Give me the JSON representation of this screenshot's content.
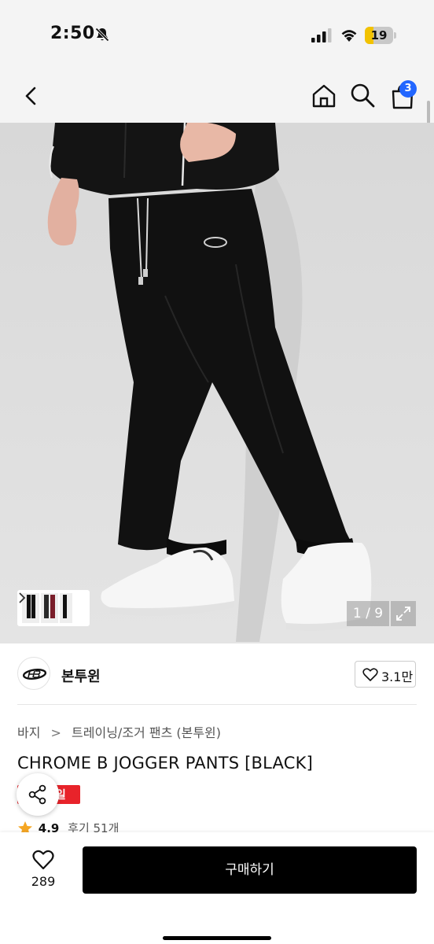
{
  "status_bar": {
    "time": "2:50",
    "battery": "19",
    "icons": [
      "bell-slash-icon",
      "cellular-signal-icon",
      "wifi-icon",
      "battery-icon"
    ]
  },
  "nav": {
    "icons": [
      "back-chevron-icon",
      "home-icon",
      "search-icon",
      "shopping-bag-icon"
    ],
    "cart_badge": "3",
    "badge_color": "#2266ff"
  },
  "gallery": {
    "page_counter": "1 / 9",
    "expand_icon": "expand-arrows-icon"
  },
  "brand": {
    "name": "본투윈",
    "like_count": "3.1만"
  },
  "breadcrumb": {
    "items": [
      "바지",
      "트레이닝/조거 팬츠 (본투윈)"
    ]
  },
  "product": {
    "title": "CHROME B JOGGER PANTS [BLACK]",
    "badge_text": "세일",
    "badge_color": "#e8232a",
    "rating": "4.9",
    "review_text": "후기 51개"
  },
  "bottom_bar": {
    "wish_count": "289",
    "buy_label": "구매하기"
  }
}
